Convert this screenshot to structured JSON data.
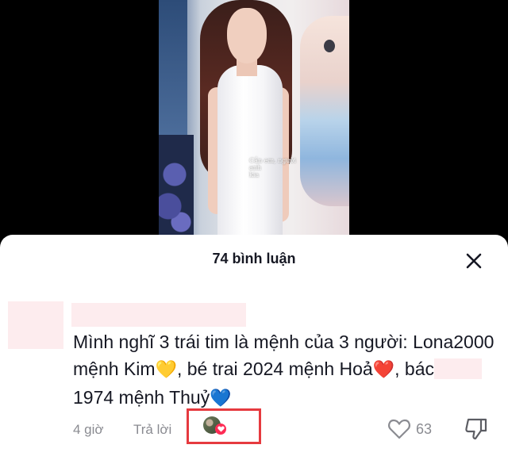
{
  "video": {
    "caption": "Cần em, người anh",
    "caption_line2": "kia"
  },
  "sheet": {
    "title": "74 bình luận",
    "close_icon": "close-icon"
  },
  "comment": {
    "text_part1": "Mình nghĩ 3 trái tim là mệnh của 3 người: Lona2000 mệnh Kim",
    "emoji_yellow_heart": "💛",
    "text_part2": ", bé trai 2024 mệnh Hoả",
    "emoji_red_heart": "❤️",
    "text_part3": ", bác",
    "text_part4": "1974 mệnh Thuỷ",
    "emoji_blue_heart": "💙",
    "time": "4 giờ",
    "reply_label": "Trả lời",
    "like_count": "63",
    "mask_color": "#fdecee"
  },
  "colors": {
    "accent_red": "#e63a3f",
    "heart_pink": "#fe2c55",
    "text_primary": "#161823",
    "text_secondary": "#8a8b91"
  }
}
